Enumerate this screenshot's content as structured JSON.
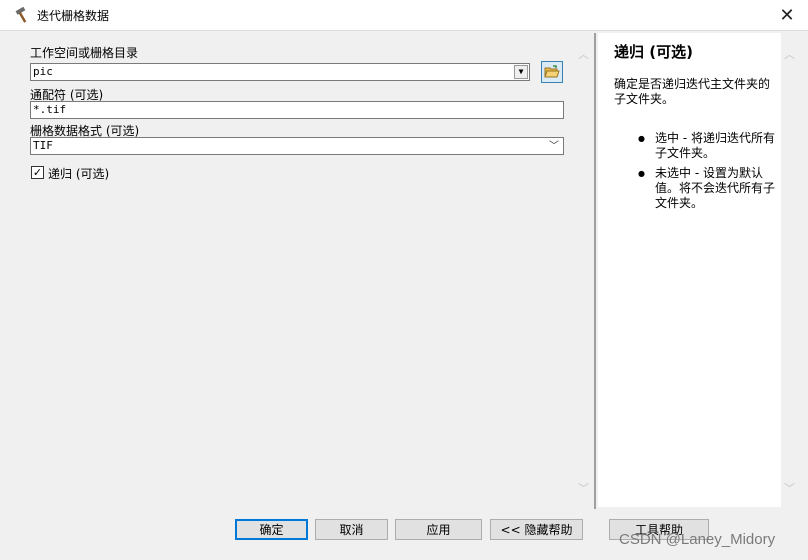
{
  "window": {
    "title": "迭代栅格数据",
    "icon": "hammer-icon",
    "close": "✕"
  },
  "form": {
    "workspace": {
      "label": "工作空间或栅格目录",
      "value": "pic"
    },
    "wildcard": {
      "label": "通配符 (可选)",
      "value": "*.tif"
    },
    "format": {
      "label": "栅格数据格式 (可选)",
      "value": "TIF"
    },
    "recursive": {
      "label": "递归 (可选)",
      "checked": true,
      "mark": "✓"
    }
  },
  "help": {
    "title": "递归 (可选)",
    "description": "确定是否递归迭代主文件夹的子文件夹。",
    "bullets": [
      "选中 - 将递归迭代所有子文件夹。",
      "未选中 - 设置为默认值。将不会迭代所有子文件夹。"
    ]
  },
  "buttons": {
    "ok": "确定",
    "cancel": "取消",
    "apply": "应用",
    "hide_help": "<< 隐藏帮助",
    "tool_help": "工具帮助"
  },
  "watermark": "CSDN @Laney_Midory",
  "colors": {
    "accent": "#0078d7",
    "help_bg": "#ffffff",
    "dialog_bg": "#f0f0f0"
  }
}
